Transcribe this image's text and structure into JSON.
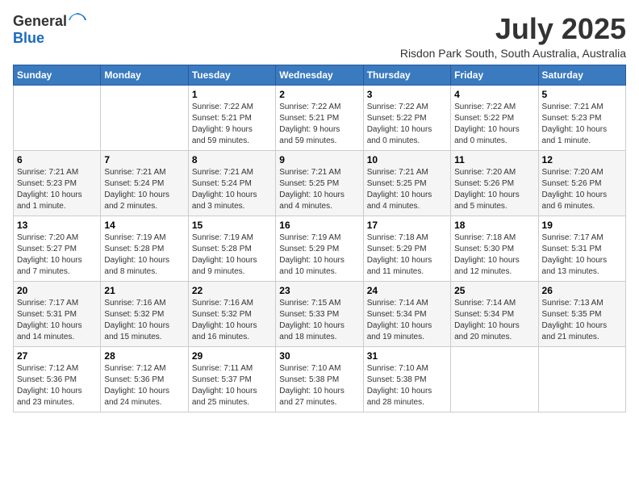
{
  "header": {
    "logo_line1": "General",
    "logo_line2": "Blue",
    "month_year": "July 2025",
    "location": "Risdon Park South, South Australia, Australia"
  },
  "weekdays": [
    "Sunday",
    "Monday",
    "Tuesday",
    "Wednesday",
    "Thursday",
    "Friday",
    "Saturday"
  ],
  "weeks": [
    [
      {
        "day": "",
        "info": ""
      },
      {
        "day": "",
        "info": ""
      },
      {
        "day": "1",
        "info": "Sunrise: 7:22 AM\nSunset: 5:21 PM\nDaylight: 9 hours\nand 59 minutes."
      },
      {
        "day": "2",
        "info": "Sunrise: 7:22 AM\nSunset: 5:21 PM\nDaylight: 9 hours\nand 59 minutes."
      },
      {
        "day": "3",
        "info": "Sunrise: 7:22 AM\nSunset: 5:22 PM\nDaylight: 10 hours\nand 0 minutes."
      },
      {
        "day": "4",
        "info": "Sunrise: 7:22 AM\nSunset: 5:22 PM\nDaylight: 10 hours\nand 0 minutes."
      },
      {
        "day": "5",
        "info": "Sunrise: 7:21 AM\nSunset: 5:23 PM\nDaylight: 10 hours\nand 1 minute."
      }
    ],
    [
      {
        "day": "6",
        "info": "Sunrise: 7:21 AM\nSunset: 5:23 PM\nDaylight: 10 hours\nand 1 minute."
      },
      {
        "day": "7",
        "info": "Sunrise: 7:21 AM\nSunset: 5:24 PM\nDaylight: 10 hours\nand 2 minutes."
      },
      {
        "day": "8",
        "info": "Sunrise: 7:21 AM\nSunset: 5:24 PM\nDaylight: 10 hours\nand 3 minutes."
      },
      {
        "day": "9",
        "info": "Sunrise: 7:21 AM\nSunset: 5:25 PM\nDaylight: 10 hours\nand 4 minutes."
      },
      {
        "day": "10",
        "info": "Sunrise: 7:21 AM\nSunset: 5:25 PM\nDaylight: 10 hours\nand 4 minutes."
      },
      {
        "day": "11",
        "info": "Sunrise: 7:20 AM\nSunset: 5:26 PM\nDaylight: 10 hours\nand 5 minutes."
      },
      {
        "day": "12",
        "info": "Sunrise: 7:20 AM\nSunset: 5:26 PM\nDaylight: 10 hours\nand 6 minutes."
      }
    ],
    [
      {
        "day": "13",
        "info": "Sunrise: 7:20 AM\nSunset: 5:27 PM\nDaylight: 10 hours\nand 7 minutes."
      },
      {
        "day": "14",
        "info": "Sunrise: 7:19 AM\nSunset: 5:28 PM\nDaylight: 10 hours\nand 8 minutes."
      },
      {
        "day": "15",
        "info": "Sunrise: 7:19 AM\nSunset: 5:28 PM\nDaylight: 10 hours\nand 9 minutes."
      },
      {
        "day": "16",
        "info": "Sunrise: 7:19 AM\nSunset: 5:29 PM\nDaylight: 10 hours\nand 10 minutes."
      },
      {
        "day": "17",
        "info": "Sunrise: 7:18 AM\nSunset: 5:29 PM\nDaylight: 10 hours\nand 11 minutes."
      },
      {
        "day": "18",
        "info": "Sunrise: 7:18 AM\nSunset: 5:30 PM\nDaylight: 10 hours\nand 12 minutes."
      },
      {
        "day": "19",
        "info": "Sunrise: 7:17 AM\nSunset: 5:31 PM\nDaylight: 10 hours\nand 13 minutes."
      }
    ],
    [
      {
        "day": "20",
        "info": "Sunrise: 7:17 AM\nSunset: 5:31 PM\nDaylight: 10 hours\nand 14 minutes."
      },
      {
        "day": "21",
        "info": "Sunrise: 7:16 AM\nSunset: 5:32 PM\nDaylight: 10 hours\nand 15 minutes."
      },
      {
        "day": "22",
        "info": "Sunrise: 7:16 AM\nSunset: 5:32 PM\nDaylight: 10 hours\nand 16 minutes."
      },
      {
        "day": "23",
        "info": "Sunrise: 7:15 AM\nSunset: 5:33 PM\nDaylight: 10 hours\nand 18 minutes."
      },
      {
        "day": "24",
        "info": "Sunrise: 7:14 AM\nSunset: 5:34 PM\nDaylight: 10 hours\nand 19 minutes."
      },
      {
        "day": "25",
        "info": "Sunrise: 7:14 AM\nSunset: 5:34 PM\nDaylight: 10 hours\nand 20 minutes."
      },
      {
        "day": "26",
        "info": "Sunrise: 7:13 AM\nSunset: 5:35 PM\nDaylight: 10 hours\nand 21 minutes."
      }
    ],
    [
      {
        "day": "27",
        "info": "Sunrise: 7:12 AM\nSunset: 5:36 PM\nDaylight: 10 hours\nand 23 minutes."
      },
      {
        "day": "28",
        "info": "Sunrise: 7:12 AM\nSunset: 5:36 PM\nDaylight: 10 hours\nand 24 minutes."
      },
      {
        "day": "29",
        "info": "Sunrise: 7:11 AM\nSunset: 5:37 PM\nDaylight: 10 hours\nand 25 minutes."
      },
      {
        "day": "30",
        "info": "Sunrise: 7:10 AM\nSunset: 5:38 PM\nDaylight: 10 hours\nand 27 minutes."
      },
      {
        "day": "31",
        "info": "Sunrise: 7:10 AM\nSunset: 5:38 PM\nDaylight: 10 hours\nand 28 minutes."
      },
      {
        "day": "",
        "info": ""
      },
      {
        "day": "",
        "info": ""
      }
    ]
  ]
}
